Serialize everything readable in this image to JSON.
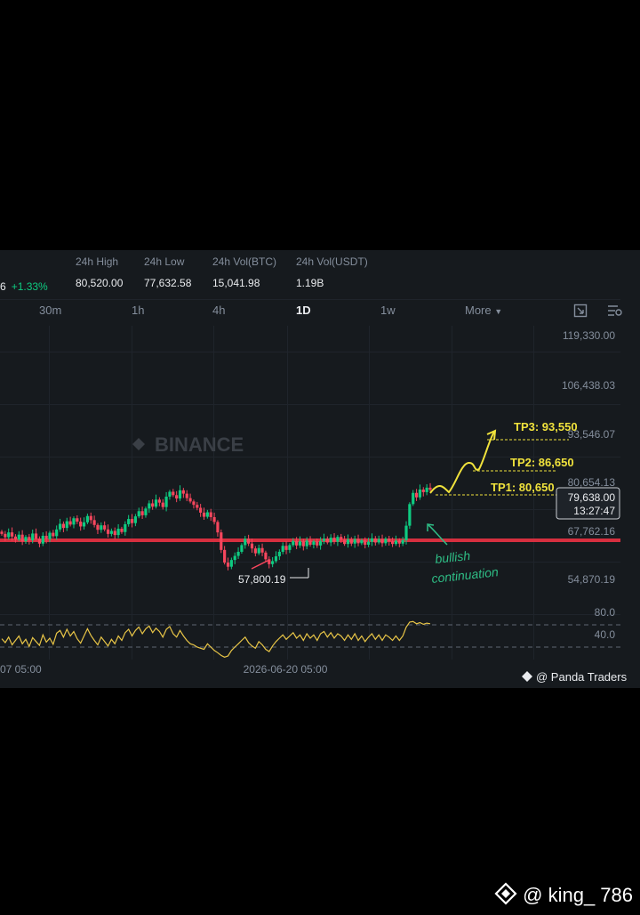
{
  "stats": {
    "price_suffix": "6",
    "change": "+1.33%",
    "items": [
      {
        "label": "24h High",
        "value": "80,520.00"
      },
      {
        "label": "24h Low",
        "value": "77,632.58"
      },
      {
        "label": "24h Vol(BTC)",
        "value": "15,041.98"
      },
      {
        "label": "24h Vol(USDT)",
        "value": "1.19B"
      }
    ]
  },
  "timeframes": [
    "30m",
    "1h",
    "4h",
    "1D",
    "1w"
  ],
  "active_timeframe": "1D",
  "more_label": "More",
  "watermark": "BINANCE",
  "credit": "@ Panda Traders",
  "footer_credit": "@ king_ 786",
  "colors": {
    "background": "#161a1e",
    "up": "#0ecb81",
    "down": "#f6465d",
    "support": "#d62f3f",
    "annotation": "#f0e23c",
    "rsi": "#e8c547",
    "arrow_note": "#2ebd85"
  },
  "chart_data": {
    "type": "candlestick",
    "price_axis_labels": [
      "119,330.00",
      "106,438.03",
      "93,546.07",
      "80,654.13",
      "67,762.16",
      "54,870.19"
    ],
    "ylim": [
      50000,
      123000
    ],
    "x_tick_labels": [
      "07 05:00",
      "2026-06-20 05:00"
    ],
    "current_price": "79,638.00",
    "countdown": "13:27:47",
    "support_level": 67762.16,
    "low_marker": "57,800.19",
    "targets": [
      {
        "label": "TP1: 80,650",
        "value": 80650
      },
      {
        "label": "TP2: 86,650",
        "value": 86650
      },
      {
        "label": "TP3: 93,550",
        "value": 93550
      }
    ],
    "annotation": [
      "bullish",
      "continuation"
    ],
    "rsi_levels": [
      "80.0",
      "40.0"
    ],
    "closes": [
      67800,
      66900,
      68200,
      67100,
      66300,
      67600,
      65800,
      67000,
      66100,
      67900,
      66500,
      65200,
      67300,
      66400,
      68100,
      67200,
      69000,
      70500,
      69400,
      71200,
      70300,
      72000,
      71100,
      69800,
      70900,
      72600,
      71500,
      70200,
      68900,
      70100,
      69000,
      67800,
      68600,
      67500,
      69200,
      68300,
      70400,
      71800,
      70700,
      72500,
      73900,
      72800,
      74600,
      76000,
      75100,
      77000,
      76200,
      75000,
      77800,
      79100,
      78200,
      77300,
      79500,
      78600,
      77400,
      76500,
      75600,
      74800,
      73500,
      72400,
      73600,
      72300,
      71000,
      68200,
      63500,
      60100,
      59000,
      60800,
      61900,
      63000,
      64800,
      66500,
      65200,
      63900,
      62600,
      64000,
      62800,
      61000,
      59700,
      60500,
      61800,
      63000,
      64600,
      63500,
      64800,
      65900,
      64700,
      65800,
      64500,
      66000,
      64900,
      65800,
      64700,
      65900,
      66500,
      65500,
      66800,
      65700,
      67000,
      66200,
      65100,
      66300,
      65200,
      66400,
      65300,
      66100,
      64900,
      65700,
      66600,
      65500,
      66400,
      65300,
      66500,
      65800,
      65100,
      66000,
      65200,
      66100,
      70000,
      75800,
      78800,
      77600,
      79700,
      79000,
      80200,
      79638
    ],
    "rsi": [
      55,
      48,
      58,
      44,
      52,
      60,
      46,
      54,
      41,
      57,
      50,
      43,
      62,
      49,
      56,
      45,
      65,
      70,
      58,
      72,
      60,
      68,
      55,
      47,
      60,
      73,
      61,
      52,
      44,
      58,
      50,
      42,
      54,
      46,
      60,
      52,
      66,
      72,
      60,
      70,
      76,
      64,
      73,
      78,
      66,
      74,
      68,
      58,
      72,
      77,
      64,
      58,
      70,
      60,
      52,
      46,
      44,
      40,
      38,
      36,
      46,
      40,
      34,
      30,
      25,
      22,
      24,
      34,
      40,
      46,
      52,
      58,
      48,
      42,
      38,
      50,
      44,
      36,
      32,
      42,
      50,
      56,
      62,
      54,
      60,
      66,
      56,
      62,
      52,
      64,
      56,
      62,
      52,
      64,
      68,
      58,
      66,
      56,
      64,
      60,
      52,
      62,
      54,
      64,
      52,
      60,
      50,
      58,
      64,
      54,
      62,
      52,
      62,
      58,
      52,
      60,
      52,
      60,
      76,
      85,
      86,
      82,
      84,
      81,
      83,
      82
    ]
  }
}
